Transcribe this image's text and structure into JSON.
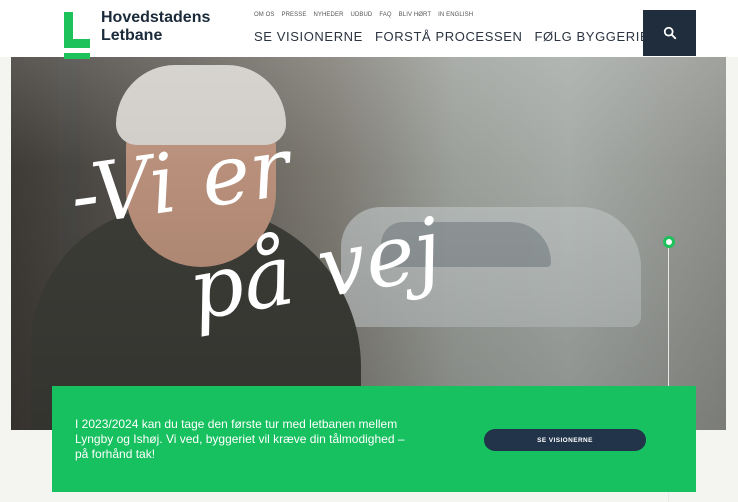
{
  "brand": {
    "name_line1": "Hovedstadens",
    "name_line2": "Letbane",
    "accent_color": "#1dc25a",
    "dark_color": "#1f2d3d"
  },
  "topnav": [
    "OM OS",
    "PRESSE",
    "NYHEDER",
    "UDBUD",
    "FAQ",
    "BLIV HØRT",
    "IN ENGLISH"
  ],
  "mainnav": [
    "SE VISIONERNE",
    "FORSTÅ PROCESSEN",
    "FØLG BYGGERIET"
  ],
  "search": {
    "icon": "search-icon"
  },
  "hero": {
    "script_line1": "-Vi er",
    "script_line2": "på vej"
  },
  "banner": {
    "text": "I 2023/2024 kan du tage den første tur med letbanen mellem Lyngby og Ishøj. Vi ved, byggeriet vil kræve din tålmodighed – på forhånd tak!",
    "button_label": "SE VISIONERNE"
  }
}
